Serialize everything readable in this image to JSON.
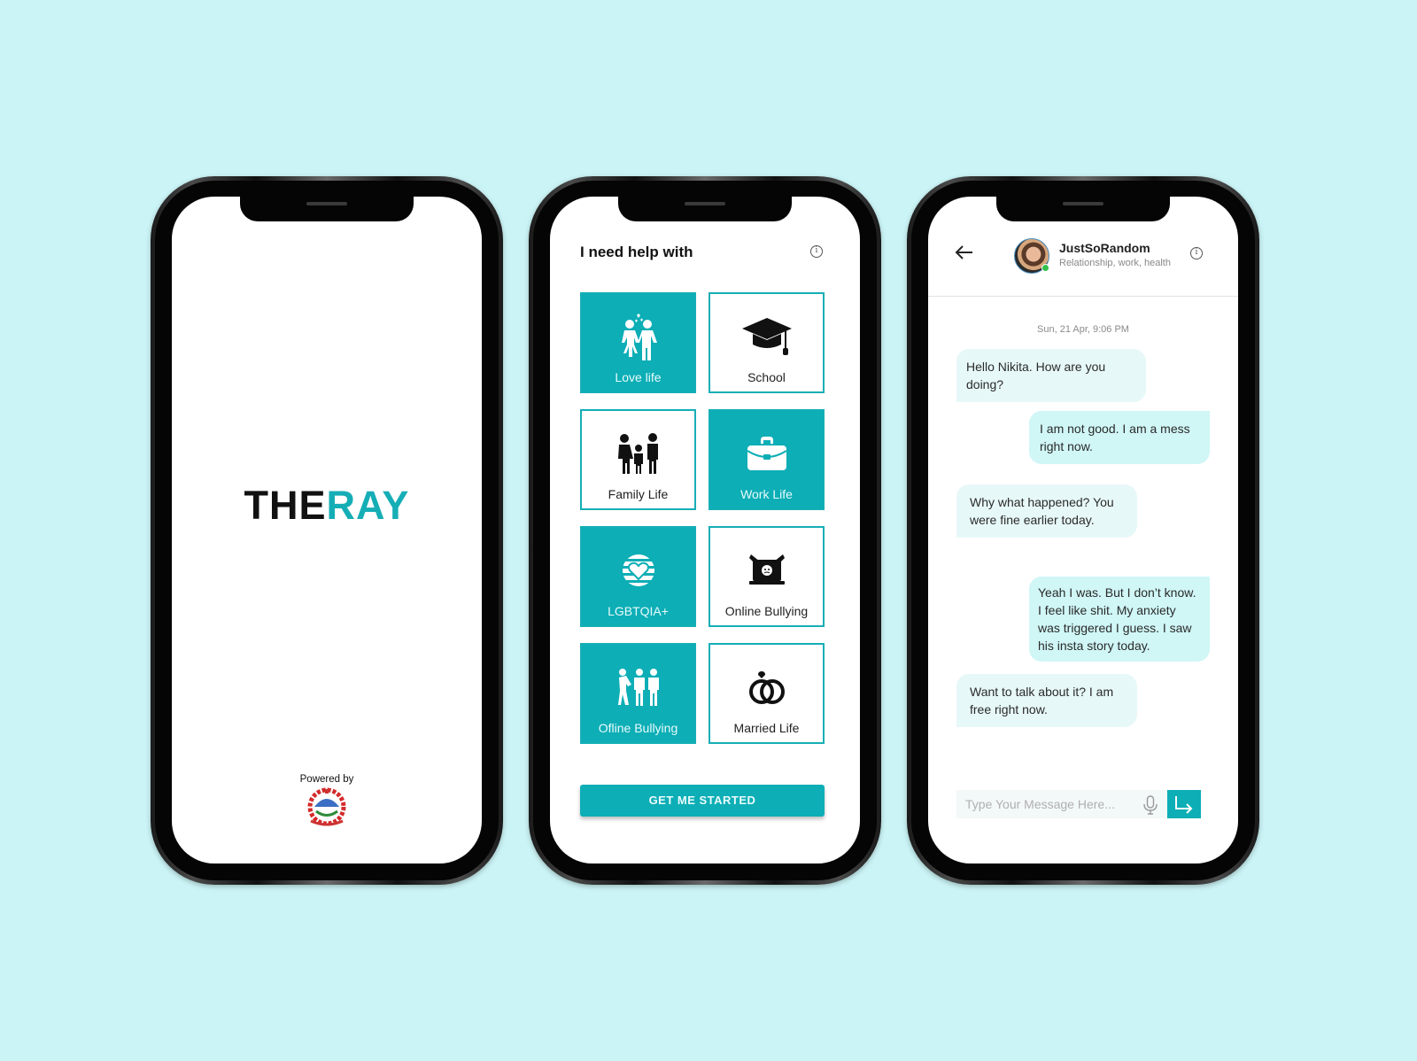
{
  "colors": {
    "background": "#cbf4f6",
    "accent": "#0daeb6",
    "bubble_in": "#e7f8f8",
    "bubble_out": "#d0f6f6"
  },
  "splash": {
    "logo_dark": "THE",
    "logo_teal": "RAY",
    "powered_by": "Powered by",
    "emblem_icon": "nepal-government-emblem-icon"
  },
  "categories": {
    "title": "I need help with",
    "info_icon": "info-icon",
    "tiles": [
      {
        "label": "Love life",
        "icon": "couple-icon",
        "selected": true
      },
      {
        "label": "School",
        "icon": "graduation-cap-icon",
        "selected": false
      },
      {
        "label": "Family Life",
        "icon": "family-icon",
        "selected": false
      },
      {
        "label": "Work Life",
        "icon": "briefcase-icon",
        "selected": true
      },
      {
        "label": "LGBTQIA+",
        "icon": "heart-globe-icon",
        "selected": true
      },
      {
        "label": "Online Bullying",
        "icon": "laptop-bully-icon",
        "selected": false
      },
      {
        "label": "Ofline Bullying",
        "icon": "group-bully-icon",
        "selected": true
      },
      {
        "label": "Married Life",
        "icon": "rings-icon",
        "selected": false
      }
    ],
    "start_button": "GET ME STARTED"
  },
  "chat": {
    "contact_name": "JustSoRandom",
    "contact_subtitle": "Relationship, work, health",
    "status": "online",
    "timestamp": "Sun, 21 Apr, 9:06 PM",
    "messages": [
      {
        "from": "them",
        "text": "Hello Nikita. How are you doing?"
      },
      {
        "from": "me",
        "text": "I am not good. I am a mess right now."
      },
      {
        "from": "them",
        "text": "Why what happened? You were fine earlier today."
      },
      {
        "from": "me",
        "text": "Yeah I was. But I don’t know. I feel like shit. My anxiety was triggered I guess. I saw his insta story today."
      },
      {
        "from": "them",
        "text": "Want to talk about it? I am free right now."
      }
    ],
    "input_placeholder": "Type Your Message Here...",
    "input_value": ""
  }
}
